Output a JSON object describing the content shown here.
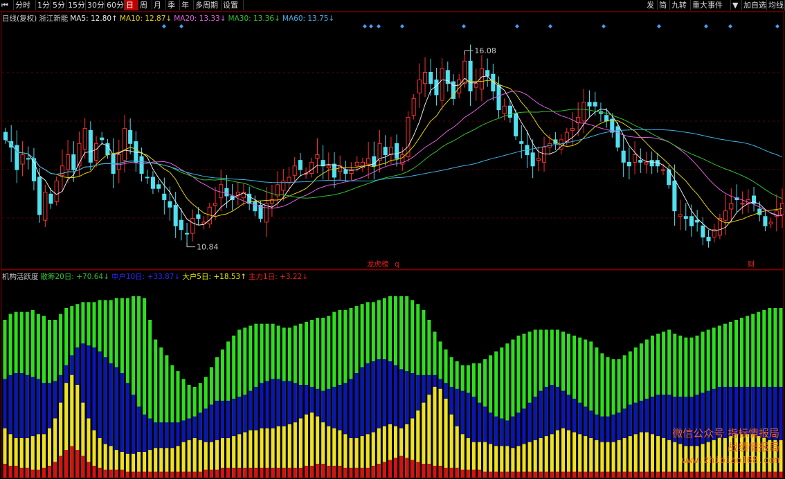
{
  "toolbar": {
    "left": [
      {
        "id": "back",
        "label": "⏮"
      },
      {
        "id": "fenshi",
        "label": "分时"
      },
      {
        "id": "1m",
        "label": "1分"
      },
      {
        "id": "5m",
        "label": "5分"
      },
      {
        "id": "15m",
        "label": "15分"
      },
      {
        "id": "30m",
        "label": "30分"
      },
      {
        "id": "60m",
        "label": "60分"
      },
      {
        "id": "day",
        "label": "日",
        "active": true
      },
      {
        "id": "week",
        "label": "周"
      },
      {
        "id": "month",
        "label": "月"
      },
      {
        "id": "season",
        "label": "季"
      },
      {
        "id": "year",
        "label": "年"
      },
      {
        "id": "multi",
        "label": "多周期"
      },
      {
        "id": "settings",
        "label": "设置"
      }
    ],
    "right": [
      {
        "id": "fa",
        "label": "发"
      },
      {
        "id": "jian",
        "label": "简"
      },
      {
        "id": "jiuzhuan",
        "label": "九转"
      },
      {
        "id": "events",
        "label": "重大事件"
      },
      {
        "id": "dropdown",
        "label": "▼"
      },
      {
        "id": "addfav",
        "label": "加自选"
      },
      {
        "id": "ma",
        "label": "均线"
      }
    ]
  },
  "legend_main": [
    {
      "text": "日线(复权)",
      "color": "#c8c8c8"
    },
    {
      "text": "浙江新能",
      "color": "#c8c8c8"
    },
    {
      "text": "MA5: 12.80↑",
      "color": "#e8e8e8"
    },
    {
      "text": "MA10: 12.87↓",
      "color": "#e6d200"
    },
    {
      "text": "MA20: 13.33↓",
      "color": "#e060e0"
    },
    {
      "text": "MA30: 13.36↓",
      "color": "#30c030"
    },
    {
      "text": "MA60: 13.75↓",
      "color": "#40b0e8"
    }
  ],
  "legend_indicator": [
    {
      "text": "机构活跃度",
      "color": "#c8c8c8"
    },
    {
      "text": "散筹20日: +70.64↓",
      "color": "#30c030"
    },
    {
      "text": "中户10日: +33.87↓",
      "color": "#2828ff"
    },
    {
      "text": "大户5日: +18.53↑",
      "color": "#e6e600"
    },
    {
      "text": "主力1日: +3.22↓",
      "color": "#e82020"
    }
  ],
  "price_annotations": {
    "high": "16.08",
    "low": "10.84"
  },
  "event_labels": [
    {
      "text": "龙虎榜",
      "color": "#e82020"
    },
    {
      "text": "q",
      "color": "#e82020"
    },
    {
      "text": "财",
      "color": "#e82020"
    }
  ],
  "watermark": {
    "line1": "微信公众号",
    "line2": "指标情报局",
    "line3": "战绩情报局",
    "url": "www.zhibiao168.com"
  },
  "colors": {
    "up": "#ff3030",
    "down": "#50e0f0",
    "green": "#30dc20",
    "blue": "#0c14b4",
    "yellow": "#f0e020",
    "red": "#d81010",
    "grid": "#5a0000"
  },
  "chart_data": [
    {
      "type": "candlestick",
      "title": "日线(复权) 浙江新能",
      "ylim": [
        10.5,
        16.6
      ],
      "max_label": 16.08,
      "min_label": 10.84,
      "close": [
        13.7,
        13.5,
        12.9,
        13.3,
        13.2,
        12.6,
        11.7,
        12.3,
        12.0,
        12.6,
        13.0,
        13.3,
        12.9,
        13.6,
        14.0,
        13.1,
        13.6,
        13.7,
        13.3,
        12.8,
        13.3,
        14.0,
        13.6,
        13.1,
        12.8,
        12.7,
        12.4,
        12.4,
        12.1,
        11.9,
        11.4,
        11.3,
        11.2,
        11.6,
        11.6,
        11.5,
        11.9,
        12.0,
        12.5,
        12.2,
        12.1,
        12.3,
        12.3,
        12.0,
        11.8,
        11.6,
        12.0,
        12.1,
        12.5,
        12.6,
        12.7,
        13.0,
        12.9,
        12.8,
        13.1,
        13.3,
        13.0,
        13.0,
        12.7,
        13.0,
        12.8,
        12.9,
        13.1,
        13.1,
        13.2,
        13.0,
        13.6,
        13.3,
        13.5,
        13.2,
        13.3,
        14.3,
        14.8,
        15.3,
        15.5,
        15.2,
        14.9,
        15.6,
        15.2,
        14.8,
        15.3,
        15.8,
        15.0,
        15.2,
        15.6,
        15.4,
        15.0,
        14.5,
        14.6,
        14.3,
        13.8,
        13.6,
        13.3,
        13.0,
        13.2,
        13.5,
        13.6,
        13.6,
        13.7,
        13.9,
        14.0,
        14.3,
        14.7,
        14.6,
        14.6,
        14.4,
        14.2,
        13.9,
        13.5,
        13.1,
        13.0,
        13.3,
        13.1,
        13.1,
        13.0,
        13.0,
        12.9,
        12.5,
        11.8,
        11.7,
        11.6,
        11.4,
        11.5,
        11.1,
        11.0,
        11.3,
        11.6,
        11.8,
        12.0,
        12.1,
        12.0,
        12.1,
        12.0,
        11.7,
        11.4,
        11.5,
        11.8,
        12.0
      ]
    },
    {
      "type": "stacked-bar",
      "title": "机构活跃度",
      "ylim": [
        0,
        100
      ],
      "series": [
        {
          "name": "散筹20日",
          "values": [
            80,
            83,
            84,
            84,
            84,
            85,
            83,
            82,
            80,
            80,
            83,
            86,
            87,
            88,
            89,
            89,
            89,
            90,
            90,
            90,
            91,
            91,
            91,
            92,
            92,
            91,
            80,
            70,
            66,
            62,
            57,
            54,
            50,
            47,
            46,
            48,
            51,
            56,
            61,
            65,
            69,
            72,
            75,
            76,
            77,
            78,
            78,
            78,
            78,
            77,
            76,
            76,
            77,
            78,
            79,
            80,
            81,
            81,
            82,
            84,
            85,
            85,
            86,
            87,
            88,
            89,
            89,
            90,
            91,
            92,
            92,
            92,
            92,
            90,
            88,
            85,
            80,
            74,
            69,
            65,
            61,
            59,
            57,
            57,
            58,
            58,
            60,
            62,
            64,
            66,
            68,
            70,
            72,
            73,
            74,
            75,
            75,
            75,
            75,
            75,
            74,
            73,
            72,
            71,
            70,
            69,
            66,
            63,
            61,
            60,
            60,
            62,
            64,
            66,
            68,
            70,
            72,
            73,
            74,
            75,
            73,
            72,
            71,
            71,
            72,
            74,
            75,
            76,
            77,
            78,
            79,
            80,
            81,
            82,
            83,
            84,
            85,
            86,
            86,
            86
          ]
        },
        {
          "name": "中户10日",
          "values": [
            50,
            52,
            53,
            53,
            52,
            51,
            50,
            48,
            48,
            49,
            52,
            57,
            62,
            66,
            68,
            67,
            66,
            64,
            61,
            58,
            56,
            53,
            48,
            42,
            36,
            32,
            30,
            28,
            28,
            28,
            28,
            28,
            29,
            30,
            31,
            33,
            35,
            37,
            39,
            39,
            39,
            40,
            41,
            42,
            44,
            46,
            48,
            49,
            50,
            50,
            49,
            49,
            48,
            47,
            47,
            46,
            45,
            44,
            45,
            46,
            47,
            48,
            50,
            53,
            56,
            58,
            59,
            60,
            60,
            59,
            57,
            55,
            54,
            53,
            52,
            52,
            52,
            52,
            50,
            48,
            46,
            45,
            44,
            43,
            41,
            38,
            36,
            33,
            31,
            30,
            29,
            31,
            33,
            35,
            38,
            41,
            44,
            46,
            47,
            46,
            44,
            42,
            40,
            38,
            36,
            34,
            32,
            31,
            31,
            32,
            33,
            35,
            37,
            38,
            39,
            40,
            41,
            42,
            42,
            42,
            41,
            41,
            41,
            41,
            42,
            43,
            44,
            45,
            46,
            46,
            46,
            46,
            46,
            46,
            46,
            46,
            46,
            46,
            46,
            46
          ]
        },
        {
          "name": "大户5日",
          "values": [
            25,
            22,
            20,
            20,
            20,
            21,
            22,
            22,
            25,
            30,
            38,
            48,
            52,
            47,
            38,
            30,
            24,
            20,
            17,
            16,
            14,
            13,
            12,
            12,
            13,
            13,
            14,
            15,
            15,
            15,
            15,
            16,
            18,
            19,
            20,
            19,
            18,
            18,
            19,
            20,
            20,
            21,
            22,
            23,
            24,
            24,
            25,
            25,
            25,
            26,
            26,
            27,
            28,
            30,
            32,
            33,
            31,
            28,
            26,
            25,
            24,
            22,
            20,
            20,
            21,
            22,
            23,
            25,
            26,
            27,
            26,
            25,
            27,
            30,
            34,
            38,
            42,
            46,
            45,
            40,
            32,
            26,
            22,
            20,
            18,
            18,
            18,
            17,
            16,
            16,
            16,
            15,
            16,
            17,
            18,
            19,
            20,
            21,
            22,
            24,
            25,
            24,
            23,
            22,
            21,
            20,
            19,
            18,
            18,
            18,
            19,
            20,
            21,
            22,
            23,
            23,
            22,
            21,
            20,
            19,
            18,
            17,
            16,
            16,
            16,
            17,
            18,
            19,
            20,
            20,
            21,
            22,
            22,
            22,
            22,
            21,
            20,
            19,
            19,
            19
          ]
        },
        {
          "name": "主力1日",
          "values": [
            7,
            6,
            6,
            5,
            5,
            4,
            4,
            5,
            6,
            8,
            11,
            14,
            16,
            14,
            11,
            8,
            6,
            5,
            4,
            4,
            4,
            4,
            3,
            3,
            3,
            3,
            3,
            3,
            3,
            3,
            3,
            3,
            3,
            3,
            3,
            3,
            4,
            4,
            4,
            5,
            5,
            5,
            5,
            5,
            5,
            5,
            5,
            5,
            5,
            5,
            5,
            5,
            5,
            5,
            6,
            6,
            7,
            7,
            6,
            6,
            6,
            5,
            5,
            5,
            5,
            5,
            6,
            7,
            8,
            9,
            10,
            11,
            10,
            9,
            8,
            7,
            7,
            6,
            6,
            5,
            5,
            5,
            4,
            4,
            4,
            4,
            3,
            3,
            3,
            3,
            3,
            3,
            3,
            3,
            3,
            3,
            3,
            3,
            3,
            3,
            3,
            3,
            3,
            3,
            3,
            3,
            3,
            3,
            3,
            3,
            3,
            3,
            3,
            3,
            3,
            3,
            3,
            3,
            3,
            3,
            3,
            3,
            3,
            3,
            3,
            3,
            3,
            3,
            3,
            3,
            3,
            3,
            3,
            3,
            3,
            3,
            3,
            3,
            3,
            3
          ]
        }
      ]
    }
  ]
}
